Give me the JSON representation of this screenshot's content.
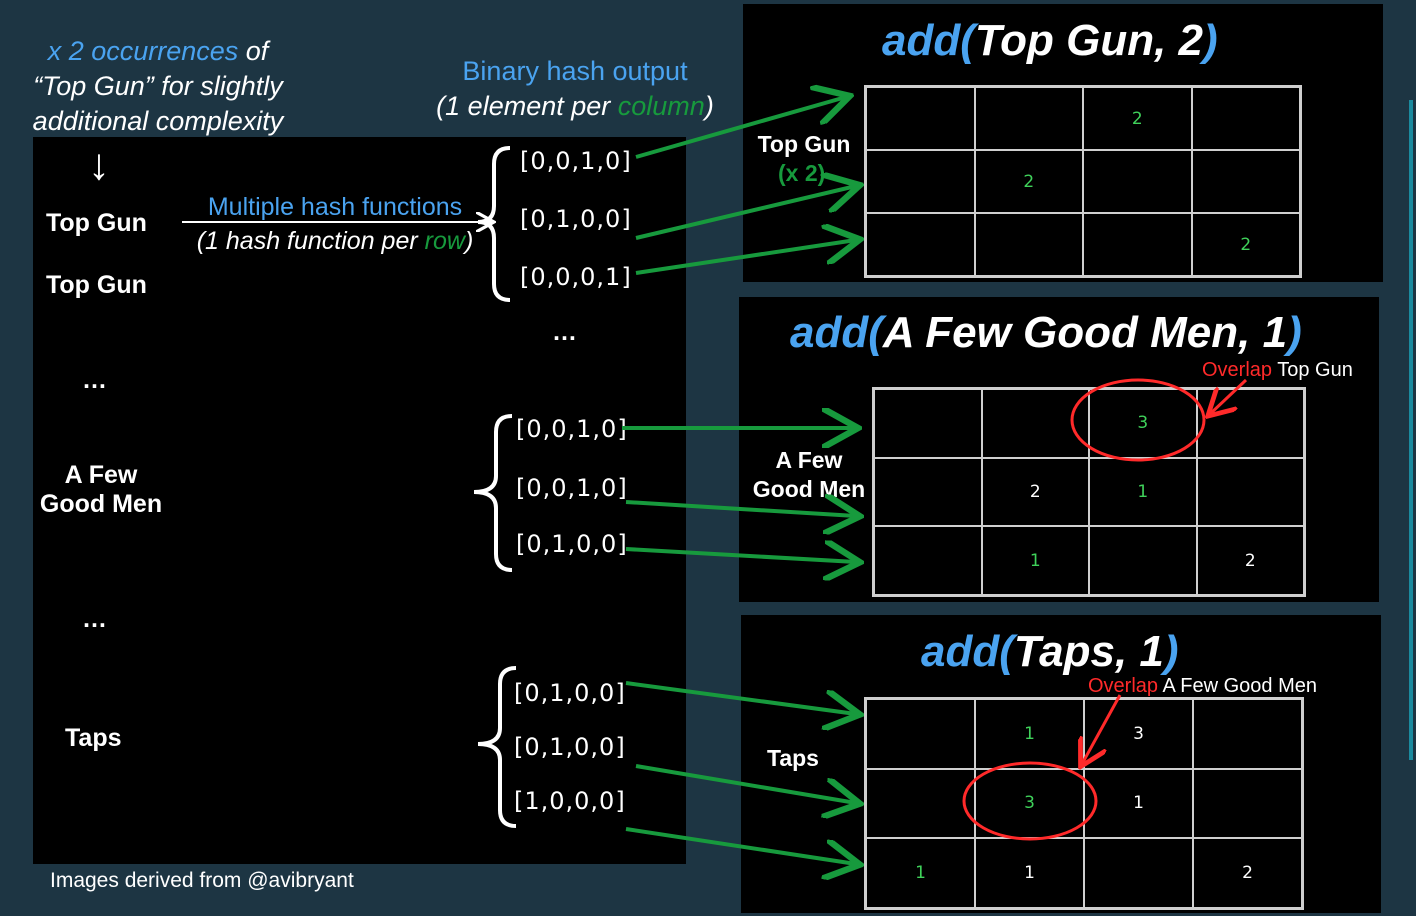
{
  "intro": {
    "line1_blue": "x 2 occurrences",
    "line1_rest": " of",
    "line2": "“Top Gun” for slightly",
    "line3": "additional complexity",
    "arrow": "↓"
  },
  "binary_header": {
    "line1": "Binary hash output",
    "line2_a": "(1 element per ",
    "line2_green": "column",
    "line2_b": ")"
  },
  "multi_hash": {
    "line1": "Multiple hash functions",
    "line2_a": "(1 hash function per ",
    "line2_green": "row",
    "line2_b": ")"
  },
  "left_items": {
    "top_gun_1": "Top Gun",
    "top_gun_2": "Top Gun",
    "dots_1": "…",
    "few_good_men_1": "A Few",
    "few_good_men_2": "Good Men",
    "dots_2": "…",
    "taps": "Taps",
    "dots_mid": "…"
  },
  "hashes": {
    "top_gun": [
      "[0,0,1,0]",
      "[0,1,0,0]",
      "[0,0,0,1]"
    ],
    "few_good_men": [
      "[0,0,1,0]",
      "[0,0,1,0]",
      "[0,1,0,0]"
    ],
    "taps": [
      "[0,1,0,0]",
      "[0,1,0,0]",
      "[1,0,0,0]"
    ]
  },
  "panels": {
    "p1": {
      "title_blue_a": "add(",
      "title_white": "Top Gun, 2",
      "title_blue_b": ")",
      "label_1": "Top Gun",
      "label_2": "(x 2)",
      "cells": [
        [
          "",
          "",
          "2",
          ""
        ],
        [
          "",
          "2",
          "",
          ""
        ],
        [
          "",
          "",
          "",
          "2"
        ]
      ]
    },
    "p2": {
      "title_blue_a": "add(",
      "title_white": "A Few Good Men, 1",
      "title_blue_b": ")",
      "overlap_red": "Overlap",
      "overlap_rest": " Top Gun",
      "label_1": "A Few",
      "label_2": "Good Men",
      "cells": [
        [
          "",
          "",
          "3",
          ""
        ],
        [
          "",
          "2",
          "1",
          ""
        ],
        [
          "",
          "1",
          "",
          "2"
        ]
      ]
    },
    "p3": {
      "title_blue_a": "add(",
      "title_white": "Taps, 1",
      "title_blue_b": ")",
      "overlap_red": "Overlap",
      "overlap_rest": " A Few Good Men",
      "label_1": "Taps",
      "cells": [
        [
          "",
          "1",
          "3",
          ""
        ],
        [
          "",
          "3",
          "1",
          ""
        ],
        [
          "1",
          "1",
          "",
          "2"
        ]
      ]
    }
  },
  "footer": "Images derived from @avibryant",
  "colors": {
    "blue": "#4aa3f0",
    "green": "#179a3d",
    "red": "#ff2a2a",
    "background": "#1d3543"
  }
}
